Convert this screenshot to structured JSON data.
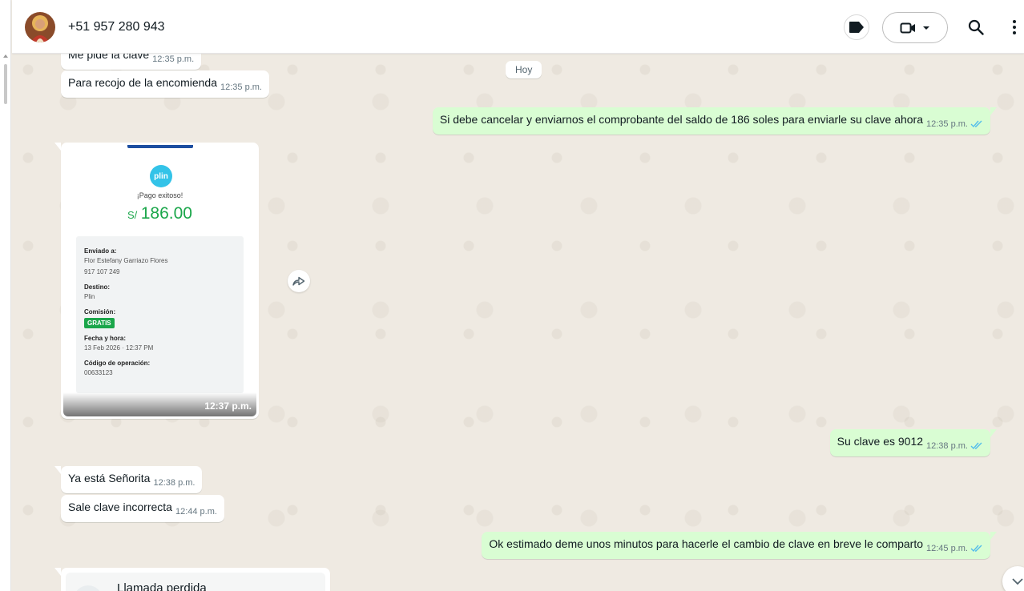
{
  "header": {
    "contact_name": "+51 957 280 943",
    "icons": [
      "label-icon",
      "video-call-icon",
      "chevron-down-icon",
      "search-icon",
      "more-vertical-icon"
    ]
  },
  "chat": {
    "date_chip": "Hoy",
    "messages": [
      {
        "dir": "in",
        "text": "Me pide la clave",
        "time": "12:35 p.m."
      },
      {
        "dir": "in",
        "text": "Para recojo de la encomienda",
        "time": "12:35 p.m."
      },
      {
        "dir": "out",
        "text": "Si debe cancelar y enviarnos el comprobante del saldo de 186 soles para enviarle su clave ahora",
        "time": "12:35 p.m.",
        "status": "read"
      },
      {
        "dir": "out",
        "text": "Su clave es 9012",
        "time": "12:38 p.m.",
        "status": "read"
      },
      {
        "dir": "in",
        "text": "Ya está Señorita",
        "time": "12:38 p.m."
      },
      {
        "dir": "in",
        "text": "Sale clave incorrecta",
        "time": "12:44 p.m."
      },
      {
        "dir": "out",
        "text": "Ok estimado deme unos minutos para hacerle el cambio de clave en breve le comparto",
        "time": "12:45 p.m.",
        "status": "read"
      }
    ],
    "image_message": {
      "time": "12:37 p.m.",
      "receipt": {
        "brand": "plin",
        "status": "¡Pago exitoso!",
        "currency": "S/",
        "amount": "186.00",
        "sent_to_label": "Enviado a:",
        "sent_to_name": "Flor Estefany Garriazo Flores",
        "sent_to_phone": "917 107 249",
        "destination_label": "Destino:",
        "destination": "Plin",
        "commission_label": "Comisión:",
        "commission": "GRATIS",
        "datetime_label": "Fecha y hora:",
        "datetime": "13 Feb 2026  ·  12:37 PM",
        "operation_label": "Código de operación:",
        "operation_code": "00633123"
      }
    },
    "missed_call": {
      "text": "Llamada perdida"
    }
  },
  "colors": {
    "outgoing_bubble": "#d9fdd3",
    "incoming_bubble": "#ffffff",
    "chat_background": "#efeae2",
    "read_ticks": "#53bdeb",
    "plin_green": "#1aa64a"
  }
}
